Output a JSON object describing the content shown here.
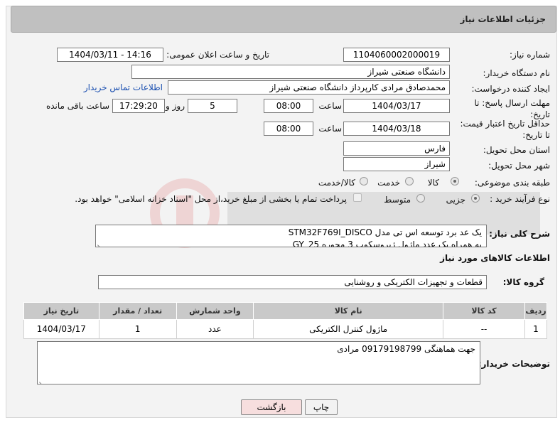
{
  "header": {
    "title": "جزئیات اطلاعات نیاز"
  },
  "need_number": {
    "label": "شماره نیاز:",
    "value": "1104060002000019"
  },
  "announce": {
    "label": "تاریخ و ساعت اعلان عمومی:",
    "value": "1404/03/11 - 14:16"
  },
  "buyer_org": {
    "label": "نام دستگاه خریدار:",
    "value": "دانشگاه صنعتی شیراز"
  },
  "requester": {
    "label": "ایجاد کننده درخواست:",
    "value": "محمدصادق مرادی کارپرداز دانشگاه صنعتی شیراز",
    "contact_link": "اطلاعات تماس خریدار"
  },
  "deadline": {
    "label": "مهلت ارسال پاسخ: تا تاریخ:",
    "date": "1404/03/17",
    "time_label": "ساعت",
    "time": "08:00",
    "days": "5",
    "days_label": "روز و",
    "remaining": "17:29:20",
    "remaining_label": "ساعت باقی مانده"
  },
  "price_validity": {
    "label": "حداقل تاریخ اعتبار قیمت: تا تاریخ:",
    "date": "1404/03/18",
    "time_label": "ساعت",
    "time": "08:00"
  },
  "province": {
    "label": "استان محل تحویل:",
    "value": "فارس"
  },
  "city": {
    "label": "شهر محل تحویل:",
    "value": "شیراز"
  },
  "category": {
    "label": "طبقه بندی موضوعی:",
    "options": [
      "کالا",
      "خدمت",
      "کالا/خدمت"
    ]
  },
  "process": {
    "label": "نوع فرآیند خرید :",
    "options": [
      "جزیی",
      "متوسط"
    ],
    "note": "پرداخت تمام یا بخشی از مبلغ خرید،از محل \"اسناد خزانه اسلامی\" خواهد بود."
  },
  "description": {
    "label": "شرح کلی نیاز:",
    "line1": "یک عد برد توسعه اس تی مدل STM32F769I_DISCO",
    "line2": "به همراه یک عدد ماژول ژیروسکوپ 3 محوره GY_25"
  },
  "goods_info": {
    "title": "اطلاعات کالاهای مورد نیاز"
  },
  "goods_group": {
    "label": "گروه کالا:",
    "value": "قطعات و تجهیزات الکتریکی و روشنایی"
  },
  "table": {
    "headers": [
      "ردیف",
      "کد کالا",
      "نام کالا",
      "واحد شمارش",
      "تعداد / مقدار",
      "تاریخ نیاز"
    ],
    "rows": [
      [
        "1",
        "--",
        "ماژول کنترل الکتریکی",
        "عدد",
        "1",
        "1404/03/17"
      ]
    ]
  },
  "buyer_notes": {
    "label": "توضیحات خریدار:",
    "value": "جهت هماهنگی 09179198799 مرادی"
  },
  "buttons": {
    "print": "چاپ",
    "back": "بازگشت"
  }
}
